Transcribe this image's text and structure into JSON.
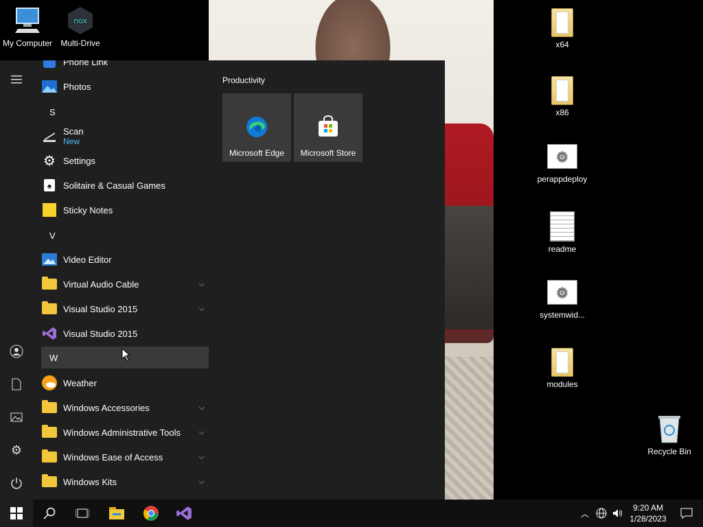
{
  "desktop": {
    "left_icons": [
      {
        "label": "My Computer"
      },
      {
        "label": "Multi-Drive"
      }
    ],
    "right_icons": [
      {
        "label": "x64"
      },
      {
        "label": "x86"
      },
      {
        "label": "perappdeploy"
      },
      {
        "label": "readme"
      },
      {
        "label": "systemwid..."
      },
      {
        "label": "modules"
      },
      {
        "label": "Recycle Bin"
      }
    ]
  },
  "start_menu": {
    "apps": [
      {
        "label": "Phone Link"
      },
      {
        "label": "Photos"
      },
      {
        "label": "Scan",
        "sub": "New"
      },
      {
        "label": "Settings"
      },
      {
        "label": "Solitaire & Casual Games"
      },
      {
        "label": "Sticky Notes"
      },
      {
        "label": "Video Editor"
      },
      {
        "label": "Virtual Audio Cable"
      },
      {
        "label": "Visual Studio 2015"
      },
      {
        "label": "Visual Studio 2015"
      },
      {
        "label": "Weather"
      },
      {
        "label": "Windows Accessories"
      },
      {
        "label": "Windows Administrative Tools"
      },
      {
        "label": "Windows Ease of Access"
      },
      {
        "label": "Windows Kits"
      }
    ],
    "letters": [
      "S",
      "V",
      "W"
    ],
    "tile_group": "Productivity",
    "tiles": [
      {
        "label": "Microsoft Edge"
      },
      {
        "label": "Microsoft Store"
      }
    ]
  },
  "taskbar": {
    "time": "9:20 AM",
    "date": "1/28/2023"
  },
  "colors": {
    "accent_link": "#4cc2ff",
    "menu_bg": "#1f1f1f",
    "folder": "#f3c73b"
  }
}
